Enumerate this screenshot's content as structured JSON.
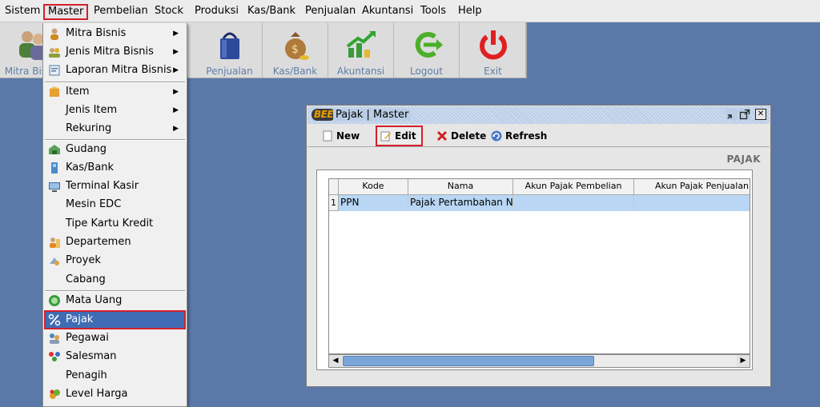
{
  "menubar": {
    "items": [
      "Sistem",
      "Master",
      "Pembelian",
      "Stock",
      "Produksi",
      "Kas/Bank",
      "Penjualan",
      "Akuntansi",
      "Tools",
      "Help"
    ],
    "active": "Master"
  },
  "toolbar": {
    "buttons": [
      {
        "label": "Mitra Bisnis",
        "icon": "users-icon"
      },
      {
        "label": "Penjualan",
        "icon": "shopping-bag-icon"
      },
      {
        "label": "Kas/Bank",
        "icon": "money-bag-icon"
      },
      {
        "label": "Akuntansi",
        "icon": "chart-up-icon"
      },
      {
        "label": "Logout",
        "icon": "logout-icon"
      },
      {
        "label": "Exit",
        "icon": "power-icon"
      }
    ]
  },
  "master_menu": {
    "items": [
      {
        "label": "Mitra Bisnis",
        "submenu": true,
        "icon": "person-icon"
      },
      {
        "label": "Jenis Mitra Bisnis",
        "submenu": true,
        "icon": "people-icon"
      },
      {
        "label": "Laporan Mitra Bisnis",
        "submenu": true,
        "icon": "report-icon"
      },
      {
        "label": "Item",
        "submenu": true,
        "icon": "box-icon"
      },
      {
        "label": "Jenis Item",
        "submenu": true,
        "icon": ""
      },
      {
        "label": "Rekuring",
        "submenu": true,
        "icon": ""
      },
      {
        "label": "Gudang",
        "submenu": false,
        "icon": "warehouse-icon"
      },
      {
        "label": "Kas/Bank",
        "submenu": false,
        "icon": "cash-icon"
      },
      {
        "label": "Terminal Kasir",
        "submenu": false,
        "icon": "terminal-icon"
      },
      {
        "label": "Mesin EDC",
        "submenu": false,
        "icon": ""
      },
      {
        "label": "Tipe Kartu Kredit",
        "submenu": false,
        "icon": ""
      },
      {
        "label": "Departemen",
        "submenu": false,
        "icon": "department-icon"
      },
      {
        "label": "Proyek",
        "submenu": false,
        "icon": "project-icon"
      },
      {
        "label": "Cabang",
        "submenu": false,
        "icon": ""
      },
      {
        "label": "Mata Uang",
        "submenu": false,
        "icon": "currency-icon"
      },
      {
        "label": "Pajak",
        "submenu": false,
        "icon": "percent-icon"
      },
      {
        "label": "Pegawai",
        "submenu": false,
        "icon": "employee-icon"
      },
      {
        "label": "Salesman",
        "submenu": false,
        "icon": "salesman-icon"
      },
      {
        "label": "Penagih",
        "submenu": false,
        "icon": ""
      },
      {
        "label": "Level Harga",
        "submenu": false,
        "icon": "price-level-icon"
      }
    ],
    "selected": "Pajak"
  },
  "window": {
    "logo": "BEE",
    "title": "Pajak | Master",
    "heading": "PAJAK",
    "toolbar": {
      "new_label": "New",
      "edit_label": "Edit",
      "delete_label": "Delete",
      "refresh_label": "Refresh"
    },
    "table": {
      "columns": [
        "Kode",
        "Nama",
        "Akun Pajak Pembelian",
        "Akun Pajak Penjualan"
      ],
      "rows": [
        {
          "num": "1",
          "cells": [
            "PPN",
            "Pajak Pertambahan Ni",
            "",
            ""
          ]
        }
      ]
    }
  },
  "colors": {
    "desktop": "#5b79a8",
    "highlight_outline": "#d2202a",
    "menu_selected": "#3f6cb4",
    "row_selected": "#b9d7f4"
  }
}
